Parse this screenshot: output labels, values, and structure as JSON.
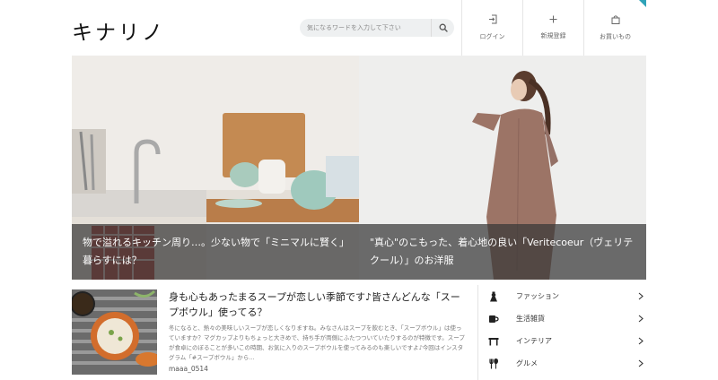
{
  "header": {
    "logo": "キナリノ",
    "search": {
      "placeholder": "気になるワードを入力して下さい",
      "icon": "search-icon"
    },
    "nav": [
      {
        "label": "ログイン",
        "icon": "login-icon"
      },
      {
        "label": "新規登録",
        "icon": "plus-icon"
      },
      {
        "label": "お買いもの",
        "icon": "shopping-bag-icon"
      }
    ],
    "accent_color": "#2fa3b8"
  },
  "hero": [
    {
      "caption": "物で溢れるキッチン周り…。少ない物で「ミニマルに賢く」暮らすには？"
    },
    {
      "caption": "\"真心\"のこもった、着心地の良い「Veritecoeur（ヴェリテクール）」のお洋服"
    }
  ],
  "article": {
    "title": "身も心もあったまるスープが恋しい季節です♪皆さんどんな「スープボウル」使ってる？",
    "description": "冬になると、熱々の美味しいスープが恋しくなりますね。みなさんはスープを飲むとき、「スープボウル」は使っていますか？マグカップよりもちょっと大きめで、持ち手が両側にふたつついていたりするのが特徴です。スープが食卓にのぼることが多いこの時期、お気に入りのスープボウルを使ってみるのも楽しいですよ♪今回はインスタグラム「#スープボウル」から...",
    "author": "maaa_0514"
  },
  "categories": [
    {
      "label": "ファッション",
      "icon": "dress-icon"
    },
    {
      "label": "生活雑貨",
      "icon": "mug-icon"
    },
    {
      "label": "インテリア",
      "icon": "table-icon"
    },
    {
      "label": "グルメ",
      "icon": "cutlery-icon"
    }
  ]
}
